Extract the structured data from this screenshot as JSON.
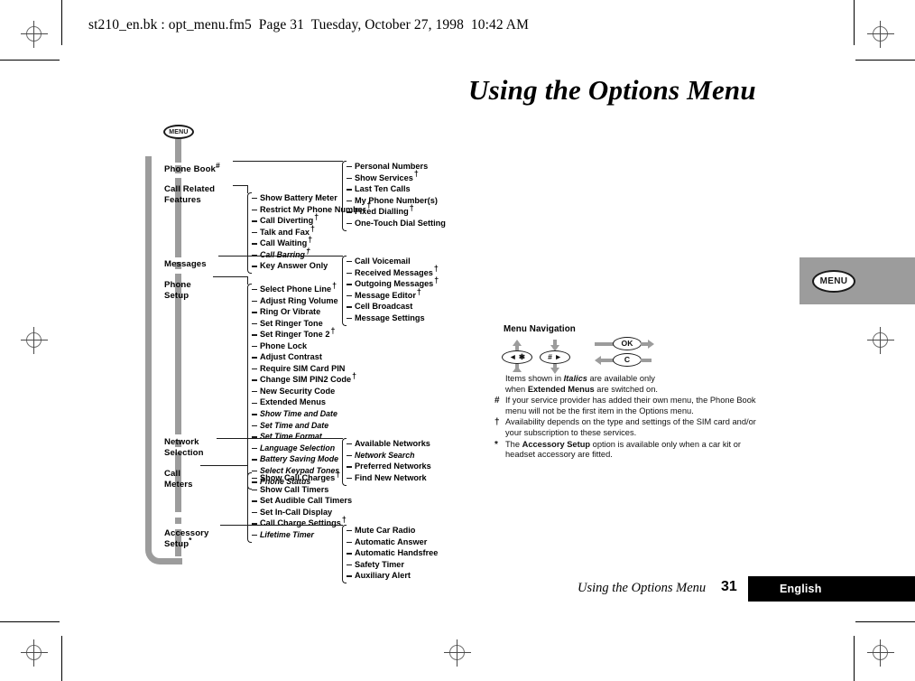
{
  "header": {
    "slug": "st210_en.bk : opt_menu.fm5  Page 31  Tuesday, October 27, 1998  10:42 AM"
  },
  "title": "Using the Options Menu",
  "side_tab": {
    "key_label": "MENU"
  },
  "tree": {
    "root_key": "MENU",
    "branches": [
      {
        "label": "Phone Book#",
        "label_text": "Phone Book",
        "marker": "#",
        "items": [
          {
            "label": "Personal Numbers",
            "mark": "",
            "italic": false
          },
          {
            "label": "Show Services",
            "mark": "†",
            "italic": false
          },
          {
            "label": "Last Ten Calls",
            "mark": "",
            "italic": false
          },
          {
            "label": "My Phone Number(s)",
            "mark": "",
            "italic": false
          },
          {
            "label": "Fixed Dialling",
            "mark": "†",
            "italic": false
          },
          {
            "label": "One-Touch Dial Setting",
            "mark": "",
            "italic": false
          }
        ]
      },
      {
        "label": "Call Related\nFeatures",
        "label_text": "Call Related\nFeatures",
        "marker": "",
        "items": [
          {
            "label": "Show Battery Meter",
            "mark": "",
            "italic": false
          },
          {
            "label": "Restrict My Phone Number",
            "mark": "†",
            "italic": false
          },
          {
            "label": "Call Diverting",
            "mark": "†",
            "italic": false
          },
          {
            "label": "Talk and Fax",
            "mark": "†",
            "italic": false
          },
          {
            "label": "Call Waiting",
            "mark": "†",
            "italic": false
          },
          {
            "label": "Call Barring",
            "mark": "†",
            "italic": true
          },
          {
            "label": "Key Answer Only",
            "mark": "",
            "italic": false
          }
        ]
      },
      {
        "label": "Messages",
        "label_text": "Messages",
        "marker": "",
        "items": [
          {
            "label": "Call Voicemail",
            "mark": "",
            "italic": false
          },
          {
            "label": "Received Messages",
            "mark": "†",
            "italic": false
          },
          {
            "label": "Outgoing Messages",
            "mark": "†",
            "italic": false
          },
          {
            "label": "Message Editor",
            "mark": "†",
            "italic": false
          },
          {
            "label": "Cell Broadcast",
            "mark": "",
            "italic": false
          },
          {
            "label": "Message Settings",
            "mark": "",
            "italic": false
          }
        ]
      },
      {
        "label": "Phone\nSetup",
        "label_text": "Phone\nSetup",
        "marker": "",
        "items": [
          {
            "label": "Select Phone Line",
            "mark": "†",
            "italic": false
          },
          {
            "label": "Adjust Ring Volume",
            "mark": "",
            "italic": false
          },
          {
            "label": "Ring Or Vibrate",
            "mark": "",
            "italic": false
          },
          {
            "label": "Set Ringer Tone",
            "mark": "",
            "italic": false
          },
          {
            "label": "Set Ringer Tone 2",
            "mark": "†",
            "italic": false
          },
          {
            "label": "Phone Lock",
            "mark": "",
            "italic": false
          },
          {
            "label": "Adjust Contrast",
            "mark": "",
            "italic": false
          },
          {
            "label": "Require SIM Card PIN",
            "mark": "",
            "italic": false
          },
          {
            "label": "Change SIM PIN2 Code",
            "mark": "†",
            "italic": false
          },
          {
            "label": "New Security Code",
            "mark": "",
            "italic": false
          },
          {
            "label": "Extended Menus",
            "mark": "",
            "italic": false
          },
          {
            "label": "Show Time and Date",
            "mark": "",
            "italic": true
          },
          {
            "label": "Set Time and Date",
            "mark": "",
            "italic": true
          },
          {
            "label": "Set Time Format",
            "mark": "",
            "italic": true
          },
          {
            "label": "Language Selection",
            "mark": "",
            "italic": true
          },
          {
            "label": "Battery Saving Mode",
            "mark": "",
            "italic": true
          },
          {
            "label": "Select Keypad Tones",
            "mark": "",
            "italic": true
          },
          {
            "label": "Phone Status",
            "mark": "",
            "italic": true
          }
        ]
      },
      {
        "label": "Network\nSelection",
        "label_text": "Network\nSelection",
        "marker": "",
        "items": [
          {
            "label": "Available Networks",
            "mark": "",
            "italic": false
          },
          {
            "label": "Network Search",
            "mark": "",
            "italic": true
          },
          {
            "label": "Preferred Networks",
            "mark": "",
            "italic": false
          },
          {
            "label": "Find New Network",
            "mark": "",
            "italic": false
          }
        ]
      },
      {
        "label": "Call\nMeters",
        "label_text": "Call\nMeters",
        "marker": "",
        "items": [
          {
            "label": "Show Call Charges",
            "mark": "†",
            "italic": false
          },
          {
            "label": "Show Call Timers",
            "mark": "",
            "italic": false
          },
          {
            "label": "Set Audible Call Timers",
            "mark": "",
            "italic": false
          },
          {
            "label": "Set In-Call Display",
            "mark": "",
            "italic": false
          },
          {
            "label": "Call Charge Settings",
            "mark": "†",
            "italic": false
          },
          {
            "label": "Lifetime Timer",
            "mark": "",
            "italic": true
          }
        ]
      },
      {
        "label": "Accessory\nSetup*",
        "label_text": "Accessory\nSetup",
        "marker": "*",
        "items": [
          {
            "label": "Mute Car Radio",
            "mark": "",
            "italic": false
          },
          {
            "label": "Automatic Answer",
            "mark": "",
            "italic": false
          },
          {
            "label": "Automatic Handsfree",
            "mark": "",
            "italic": false
          },
          {
            "label": "Safety Timer",
            "mark": "",
            "italic": false
          },
          {
            "label": "Auxiliary Alert",
            "mark": "",
            "italic": false
          }
        ]
      }
    ]
  },
  "navigation": {
    "title": "Menu Navigation",
    "key_star": "◄ ✱",
    "key_hash": "# ►",
    "key_ok": "OK",
    "key_clear": "C"
  },
  "footnotes": [
    {
      "marker": "",
      "segments": [
        {
          "text": "Items shown in ",
          "style": "normal"
        },
        {
          "text": "Italics",
          "style": "bolditalic"
        },
        {
          "text": " are available only",
          "style": "normal"
        },
        {
          "text": "\nwhen ",
          "style": "normal"
        },
        {
          "text": "Extended Menus",
          "style": "bold"
        },
        {
          "text": " are switched on.",
          "style": "normal"
        }
      ]
    },
    {
      "marker": "#",
      "segments": [
        {
          "text": "If your service provider has added their own menu, the Phone Book menu will not be the first item in the Options menu.",
          "style": "normal"
        }
      ]
    },
    {
      "marker": "†",
      "segments": [
        {
          "text": "Availability depends on the type and settings of the SIM card and/or your subscription to these services.",
          "style": "normal"
        }
      ]
    },
    {
      "marker": "*",
      "segments": [
        {
          "text": "The ",
          "style": "normal"
        },
        {
          "text": "Accessory Setup",
          "style": "bold"
        },
        {
          "text": " option is available only when a car kit or headset accessory are fitted.",
          "style": "normal"
        }
      ]
    }
  ],
  "footer": {
    "chapter": "Using the Options Menu",
    "page_number": "31",
    "language": "English"
  },
  "colors": {
    "trunk_gray": "#9c9c9c",
    "ink": "#000000",
    "tab_gray": "#9c9c9c",
    "footer_bar": "#000000"
  }
}
